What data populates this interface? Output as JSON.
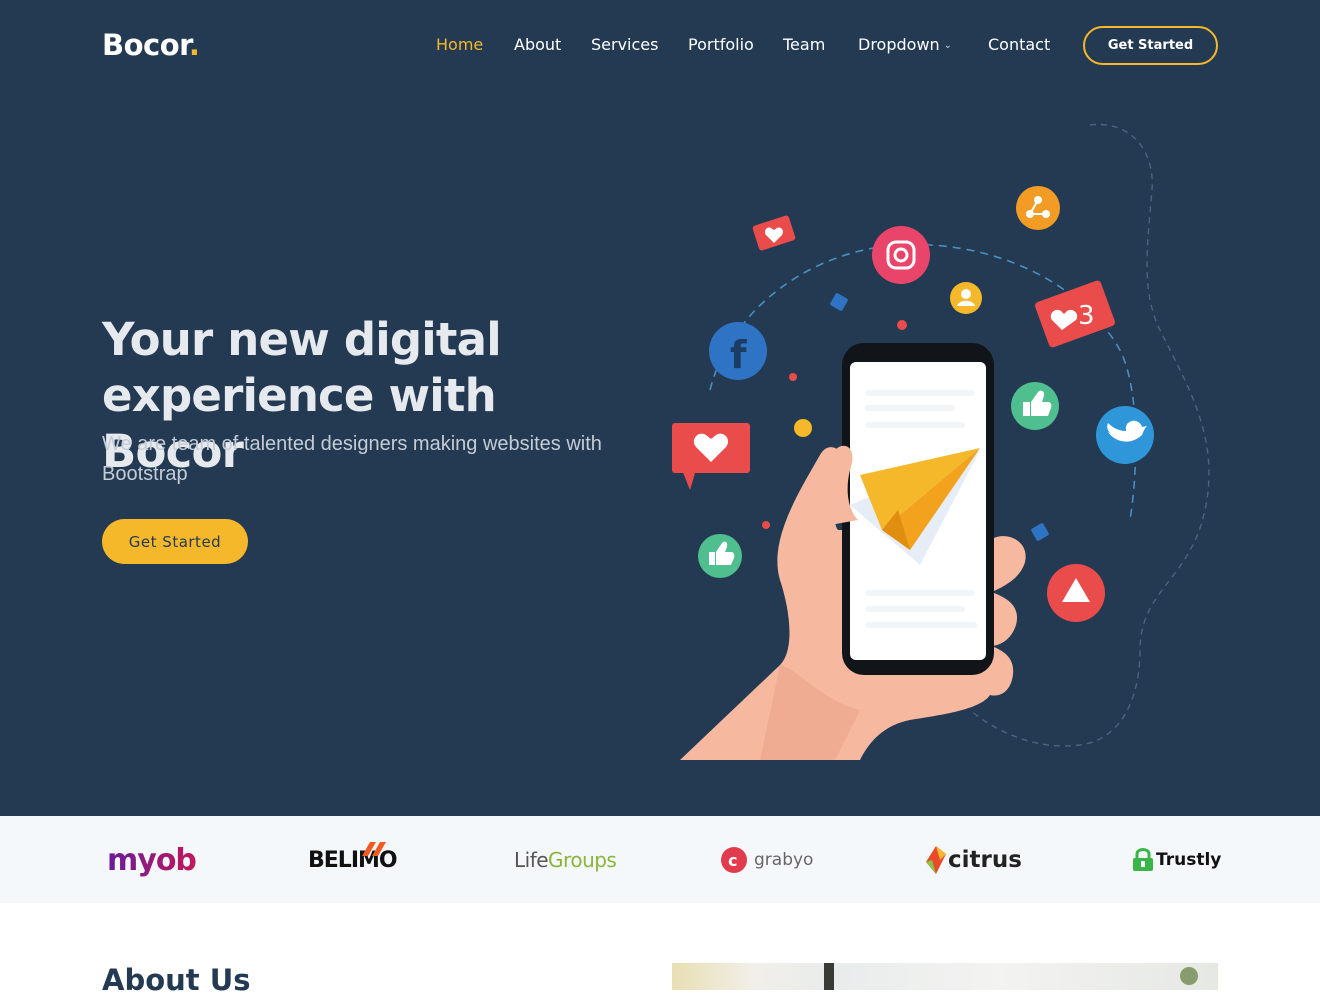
{
  "brand": {
    "name": "Bocor",
    "dot": ".",
    "accent": "#f6b82b",
    "bg": "#233a52"
  },
  "nav": {
    "items": [
      {
        "label": "Home",
        "active": true
      },
      {
        "label": "About"
      },
      {
        "label": "Services"
      },
      {
        "label": "Portfolio"
      },
      {
        "label": "Team"
      },
      {
        "label": "Dropdown",
        "icon": "chevron-down-icon"
      },
      {
        "label": "Contact"
      }
    ],
    "cta": "Get Started"
  },
  "hero": {
    "title_line1": "Your new digital",
    "title_line2": "experience with Bocor",
    "subtitle": "We are team of talented designers making websites with Bootstrap",
    "cta": "Get Started",
    "illustration": "hand-holding-phone-with-social-icons"
  },
  "clients": [
    {
      "name": "myob",
      "color": "#6a1b9a"
    },
    {
      "name": "BELIMO",
      "color": "#111111"
    },
    {
      "name_a": "Life",
      "name_b": "Groups",
      "color": "#6b7b2b"
    },
    {
      "name": "grabyo",
      "color": "#555555"
    },
    {
      "name": "citrus",
      "color": "#222222"
    },
    {
      "name": "Trustly",
      "color": "#111111"
    }
  ],
  "about": {
    "title": "About Us"
  }
}
